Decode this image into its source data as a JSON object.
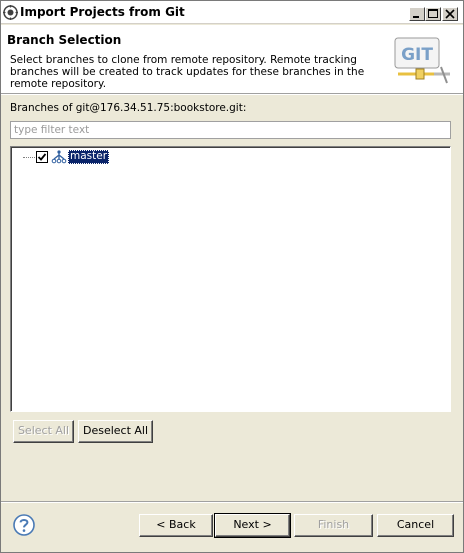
{
  "window": {
    "title": "Import Projects from Git",
    "icons": {
      "app": "eclipse-icon",
      "minimize": "minimize-icon",
      "maximize": "maximize-icon",
      "close": "close-icon"
    }
  },
  "header": {
    "title": "Branch Selection",
    "description": "Select branches to clone from remote repository. Remote tracking branches will be created to track updates for these branches in the remote repository.",
    "logo_icon": "git-logo",
    "logo_text": "GIT"
  },
  "branches": {
    "label": "Branches of git@176.34.51.75:bookstore.git:",
    "filter_placeholder": "type filter text",
    "filter_value": "",
    "items": [
      {
        "label": "master",
        "checked": true,
        "selected": true,
        "icon": "branch-icon"
      }
    ]
  },
  "selection_buttons": {
    "select_all": "Select All",
    "deselect_all": "Deselect All"
  },
  "footer": {
    "help_icon": "help-icon",
    "back": "< Back",
    "next": "Next >",
    "finish": "Finish",
    "cancel": "Cancel"
  },
  "colors": {
    "selection": "#0a246a",
    "dialog_bg": "#ece9d8",
    "help_blue": "#4a7ab5"
  }
}
